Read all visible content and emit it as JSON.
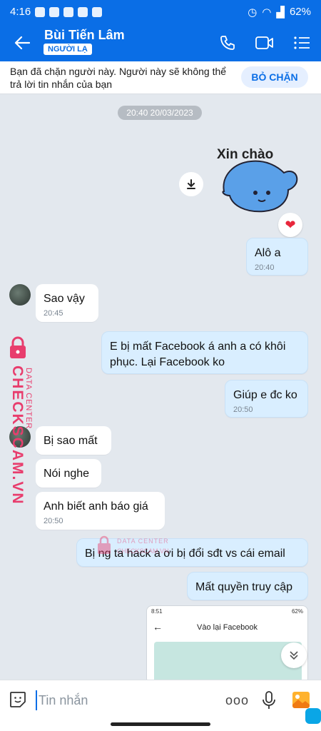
{
  "status": {
    "time": "4:16",
    "battery": "62%"
  },
  "header": {
    "name": "Bùi Tiến Lâm",
    "badge": "NGƯỜI LẠ"
  },
  "block_bar": {
    "text": "Bạn đã chặn người này. Người này sẽ không thể trả lời tin nhắn của bạn",
    "button": "BỎ CHẶN"
  },
  "date_divider": "20:40 20/03/2023",
  "sticker_text": "Xin chào",
  "messages": {
    "m1": {
      "text": "Alô a",
      "time": "20:40"
    },
    "m2": {
      "text": "Sao vậy",
      "time": "20:45"
    },
    "m3": {
      "text": "E bị mất Facebook á anh a có khôi phục. Lại Facebook ko"
    },
    "m4": {
      "text": "Giúp e đc ko",
      "time": "20:50"
    },
    "m5": {
      "text": "Bị sao mất"
    },
    "m6": {
      "text": "Nói nghe"
    },
    "m7": {
      "text": "Anh biết anh báo giá",
      "time": "20:50"
    },
    "m8": {
      "text": "Bị ng ta hack a ơi bị đổi sđt vs cái email"
    },
    "m9": {
      "text": "Mất quyền truy cập"
    }
  },
  "image_preview": {
    "time": "8:51",
    "battery": "62%",
    "title": "Vào lại Facebook"
  },
  "watermark": {
    "main": "CHECKSCAM.VN",
    "sub": "DATA CENTER",
    "sub2": "DATA CENTER",
    "sub3": "CHECKSCAM.VN"
  },
  "composer": {
    "placeholder": "Tin nhắn",
    "more": "ooo"
  },
  "colors": {
    "brand": "#0a6ee6",
    "outgoing": "#d9eeff",
    "incoming": "#ffffff",
    "watermark": "#e83d6d"
  }
}
